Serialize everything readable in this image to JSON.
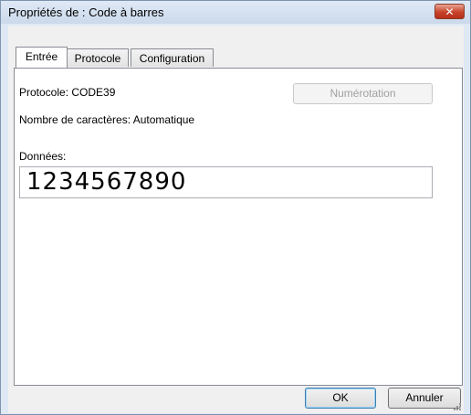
{
  "window": {
    "title": "Propriétés de : Code à barres",
    "close_label": "✕"
  },
  "tabs": [
    {
      "label": "Entrée",
      "active": true
    },
    {
      "label": "Protocole",
      "active": false
    },
    {
      "label": "Configuration",
      "active": false
    }
  ],
  "entree": {
    "protocol_text": "Protocole: CODE39",
    "characters_text": "Nombre de caractères: Automatique",
    "numbering_button": "Numérotation",
    "data_label": "Données:",
    "data_value": "1234567890"
  },
  "footer": {
    "ok_label": "OK",
    "cancel_label": "Annuler"
  }
}
